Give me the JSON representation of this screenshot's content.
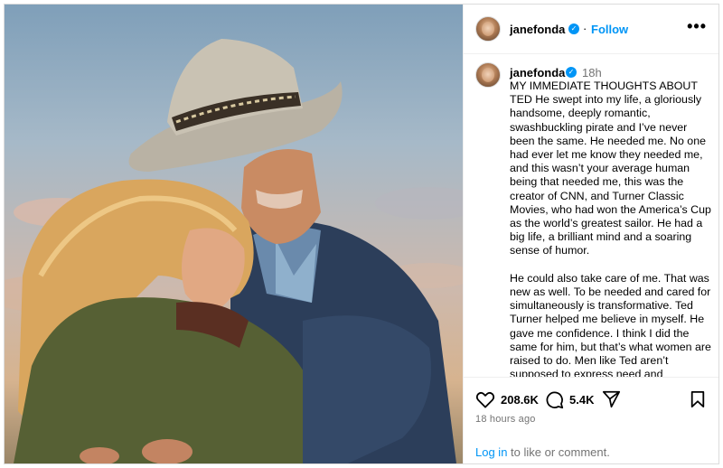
{
  "post": {
    "username": "janefonda",
    "verified": true,
    "follow_label": "Follow",
    "more_label": "•••",
    "time_short": "18h",
    "caption": "MY IMMEDIATE THOUGHTS ABOUT TED He swept into my life, a gloriously handsome, deeply romantic, swashbuckling pirate and I’ve never been the same. He needed me. No one had ever let me know they needed me, and this wasn’t your average human being that needed me, this was the creator of CNN, and Turner Classic Movies, who had won the America’s Cup as the world’s greatest sailor. He had a big life, a brilliant mind and a soaring sense of humor.\n\nHe could also take care of me. That was new as well. To be needed and cared for simultaneously is transformative. Ted Turner helped me believe in myself. He gave me confidence. I think I did the same for him, but that’s what women are raised to do. Men like Ted aren’t supposed to express need and",
    "likes": "208.6K",
    "comments": "5.4K",
    "time_long": "18 hours ago",
    "login_link": "Log in",
    "login_suffix": " to like or comment."
  },
  "icons": {
    "verified": "verified-check-icon",
    "like": "heart-icon",
    "comment": "speech-bubble-icon",
    "share": "paper-plane-icon",
    "save": "bookmark-icon",
    "more": "ellipsis-icon"
  },
  "colors": {
    "link": "#0095f6",
    "muted": "#737373",
    "border": "#dbdbdb"
  }
}
